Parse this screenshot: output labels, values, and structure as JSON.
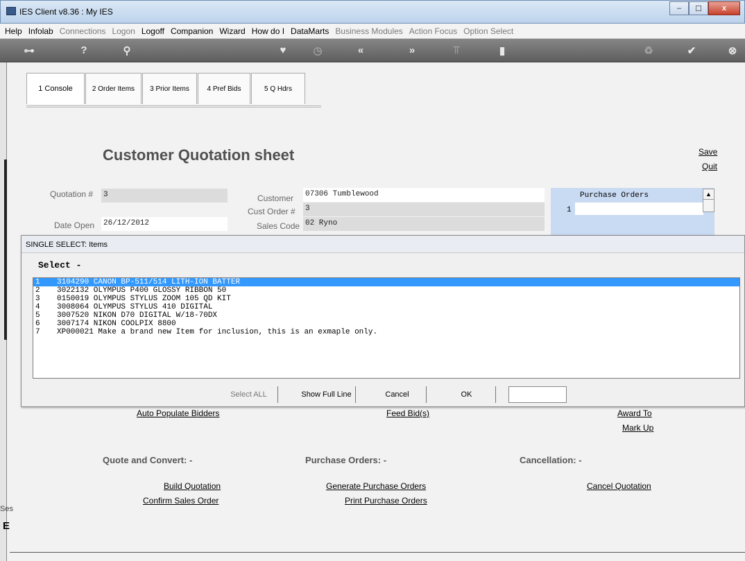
{
  "window": {
    "title": "IES Client v8.36 : My IES",
    "min_glyph": "–",
    "max_glyph": "☐",
    "close_glyph": "x"
  },
  "menu": {
    "help": "Help",
    "infolab": "Infolab",
    "connections": "Connections",
    "logon": "Logon",
    "logoff": "Logoff",
    "companion": "Companion",
    "wizard": "Wizard",
    "howdoi": "How do I",
    "datamarts": "DataMarts",
    "business_modules": "Business Modules",
    "action_focus": "Action Focus",
    "option_select": "Option Select"
  },
  "toolbar": {
    "key": "⊶",
    "help": "?",
    "search": "⚲",
    "heart": "♥",
    "clock": "◷",
    "back": "«",
    "forward": "»",
    "tools": "⫪",
    "page": "▮",
    "recycle": "♻",
    "check": "✔",
    "close": "⊗"
  },
  "tabs": [
    {
      "label": "1 Console"
    },
    {
      "label": "2 Order Items"
    },
    {
      "label": "3 Prior Items"
    },
    {
      "label": "4 Pref Bids"
    },
    {
      "label": "5 Q Hdrs"
    }
  ],
  "sheet": {
    "title": "Customer Quotation sheet",
    "save": "Save",
    "quit": "Quit"
  },
  "form": {
    "quotation_label": "Quotation #",
    "quotation_value": "3",
    "date_open_label": "Date Open",
    "date_open_value": "26/12/2012",
    "customer_label": "Customer",
    "customer_value": "07306 Tumblewood",
    "cust_order_label": "Cust Order #",
    "cust_order_value": "3",
    "sales_code_label": "Sales Code",
    "sales_code_value": "02 Ryno"
  },
  "purchase_orders": {
    "header": "Purchase Orders",
    "row_num": "1",
    "scroll_up": "▲"
  },
  "modal": {
    "title": "SINGLE SELECT: Items",
    "select_label": "Select -",
    "items": [
      {
        "n": "1",
        "text": "3104290 CANON BP-511/514 LITH-ION BATTER"
      },
      {
        "n": "2",
        "text": "3022132 OLYMPUS P400 GLOSSY RIBBON 50"
      },
      {
        "n": "3",
        "text": "0150019 OLYMPUS STYLUS ZOOM 105 QD KIT"
      },
      {
        "n": "4",
        "text": "3008064 OLYMPUS STYLUS 410 DIGITAL"
      },
      {
        "n": "5",
        "text": "3007520 NIKON D70 DIGITAL W/18-70DX"
      },
      {
        "n": "6",
        "text": "3007174 NIKON COOLPIX 8800"
      },
      {
        "n": "7",
        "text": "XP000021 Make a brand new Item for inclusion, this is an exmaple only."
      }
    ],
    "select_all": "Select ALL",
    "show_full_line": "Show Full Line",
    "cancel": "Cancel",
    "ok": "OK"
  },
  "actions": {
    "auto_populate": "Auto Populate Bidders",
    "feed_bids": "Feed Bid(s)",
    "award_to": "Award To",
    "mark_up": "Mark Up",
    "quote_convert": "Quote and Convert: -",
    "purchase_orders_section": "Purchase Orders: -",
    "cancellation_section": "Cancellation: -",
    "build_quotation": "Build Quotation",
    "confirm_sales_order": "Confirm Sales Order",
    "generate_po": "Generate Purchase Orders",
    "print_po": "Print Purchase Orders",
    "cancel_quotation": "Cancel Quotation"
  },
  "status": {
    "ses": "Ses",
    "mark": "E"
  }
}
